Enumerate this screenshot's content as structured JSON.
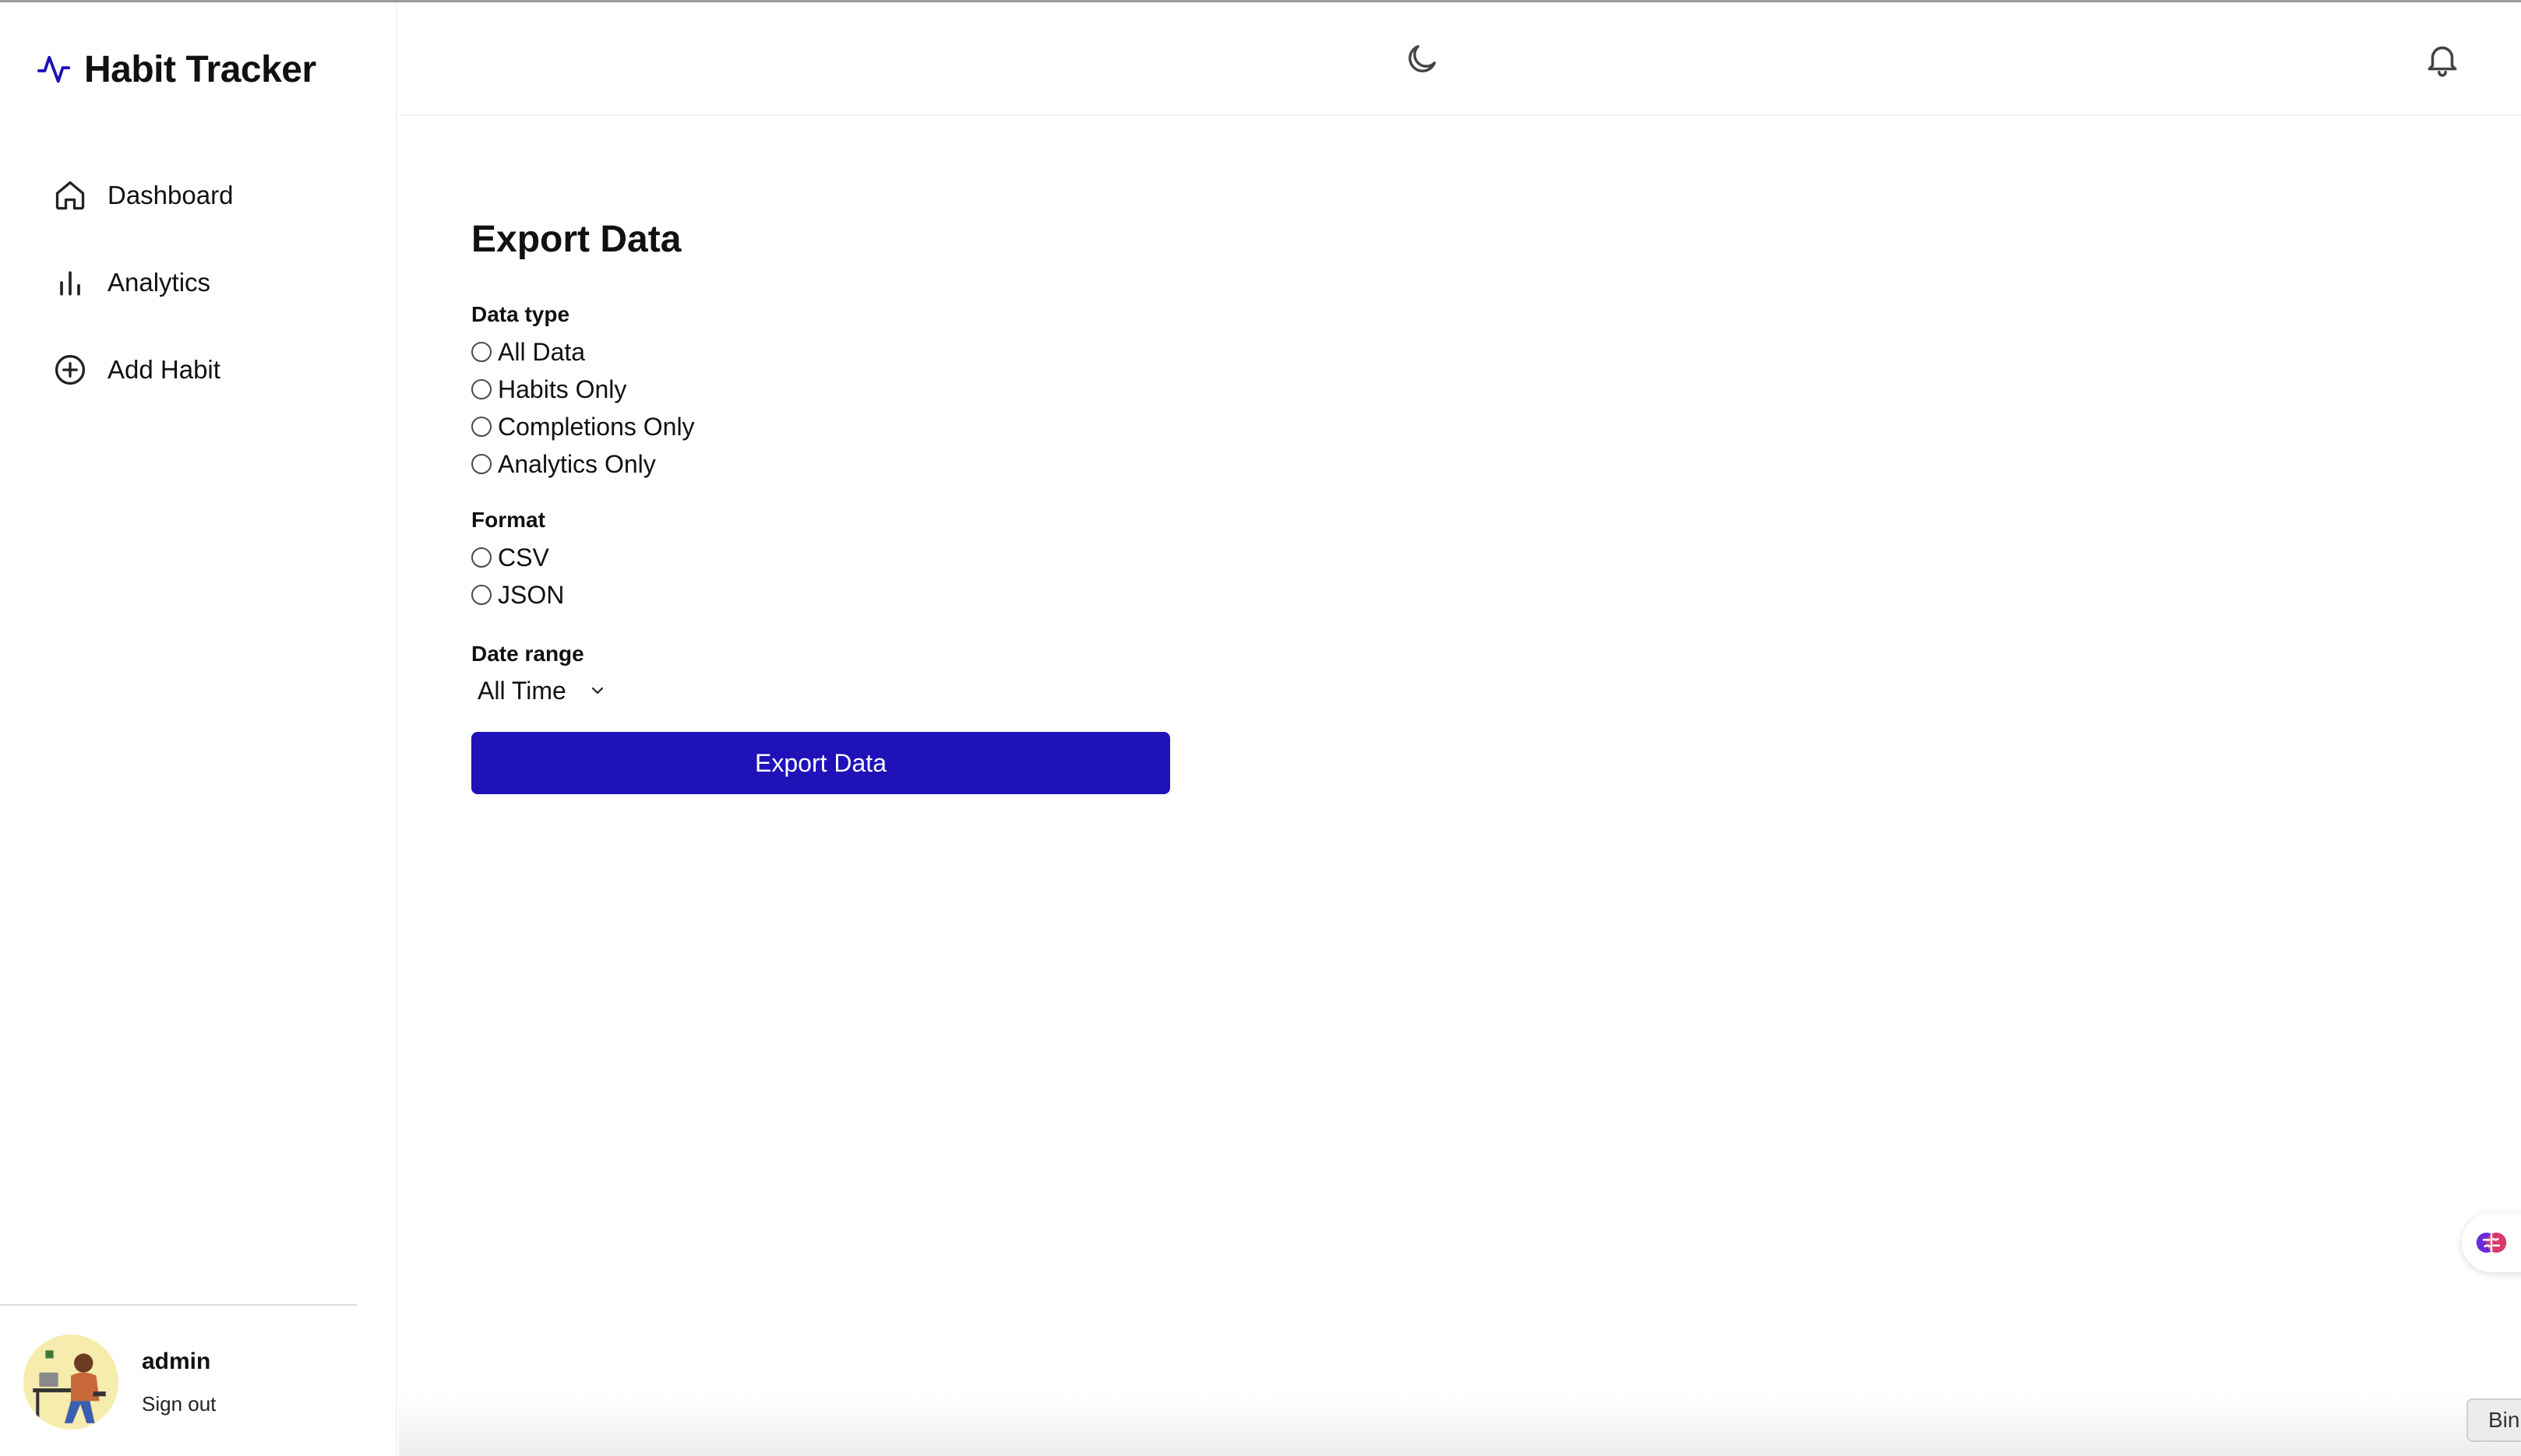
{
  "app": {
    "brand_name": "Habit Tracker",
    "accent_color": "#1e12b8"
  },
  "sidebar": {
    "items": [
      {
        "label": "Dashboard",
        "icon": "home-icon"
      },
      {
        "label": "Analytics",
        "icon": "bar-chart-icon"
      },
      {
        "label": "Add Habit",
        "icon": "plus-circle-icon"
      }
    ],
    "user": {
      "name": "admin",
      "sign_out_label": "Sign out"
    }
  },
  "header": {
    "theme_icon": "moon-icon",
    "notifications_icon": "bell-icon"
  },
  "main": {
    "title": "Export Data",
    "data_type": {
      "label": "Data type",
      "options": [
        "All Data",
        "Habits Only",
        "Completions Only",
        "Analytics Only"
      ]
    },
    "format": {
      "label": "Format",
      "options": [
        "CSV",
        "JSON"
      ]
    },
    "date_range": {
      "label": "Date range",
      "selected": "All Time"
    },
    "export_button_label": "Export Data"
  },
  "overlay": {
    "corner_tab_text": "Bin",
    "float_widget_icon": "brain-icon"
  }
}
